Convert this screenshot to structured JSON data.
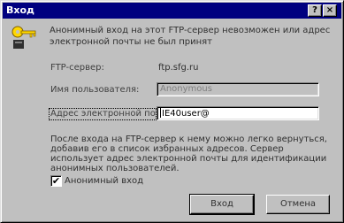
{
  "window": {
    "title": "Вход",
    "help_button": "?",
    "close_button": "×"
  },
  "icons": {
    "dialog_icon": "key-icon"
  },
  "message": "Анонимный вход на этот FTP-сервер невозможен или адрес электронной почты не был принят",
  "form": {
    "ftp_server_label": "FTP-сервер:",
    "ftp_server_value": "ftp.sfg.ru",
    "username_label": "Имя пользователя:",
    "username_value": "Anonymous",
    "email_label": "Адрес электронной почты:",
    "email_value": "IE40user@"
  },
  "info_text": "После входа на FTP-сервер к нему можно легко вернуться, добавив его в список избранных адресов. Сервер использует адрес электронной почты для идентификации анонимных пользователей.",
  "anonymous_checkbox": {
    "label": "Анонимный вход",
    "checked": true,
    "mark": "✔"
  },
  "buttons": {
    "login": "Вход",
    "cancel": "Отмена"
  }
}
